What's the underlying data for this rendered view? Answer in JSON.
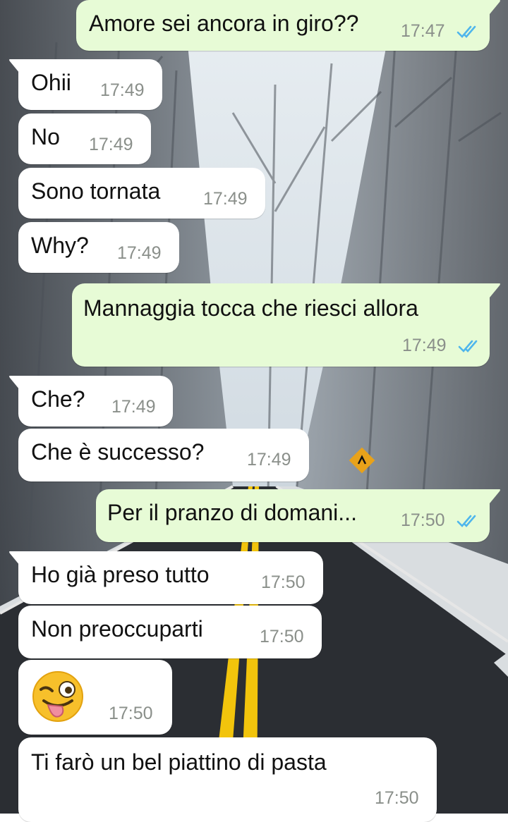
{
  "conversation": {
    "messages": [
      {
        "dir": "out",
        "text": "Amore sei ancora in giro??",
        "time": "17:47",
        "status": "read"
      },
      {
        "dir": "in",
        "text": "Ohii",
        "time": "17:49"
      },
      {
        "dir": "in",
        "text": "No",
        "time": "17:49"
      },
      {
        "dir": "in",
        "text": "Sono tornata",
        "time": "17:49"
      },
      {
        "dir": "in",
        "text": "Why?",
        "time": "17:49"
      },
      {
        "dir": "out",
        "text": "Mannaggia tocca che riesci allora",
        "time": "17:49",
        "status": "read"
      },
      {
        "dir": "in",
        "text": "Che?",
        "time": "17:49"
      },
      {
        "dir": "in",
        "text": "Che è successo?",
        "time": "17:49"
      },
      {
        "dir": "out",
        "text": "Per il pranzo di domani...",
        "time": "17:50",
        "status": "read"
      },
      {
        "dir": "in",
        "text": "Ho già preso tutto",
        "time": "17:50"
      },
      {
        "dir": "in",
        "text": "Non preoccuparti",
        "time": "17:50"
      },
      {
        "dir": "in",
        "emoji": "winking-face-with-tongue",
        "time": "17:50"
      },
      {
        "dir": "in",
        "text": "Ti farò un bel piattino di pasta",
        "time": "17:50"
      }
    ]
  },
  "theme": {
    "incoming_bubble": "#ffffff",
    "outgoing_bubble": "#e7fbd6",
    "read_ticks": "#4fb6ec",
    "road": "#2b2e33",
    "lane_lines": "#f2c40c"
  }
}
